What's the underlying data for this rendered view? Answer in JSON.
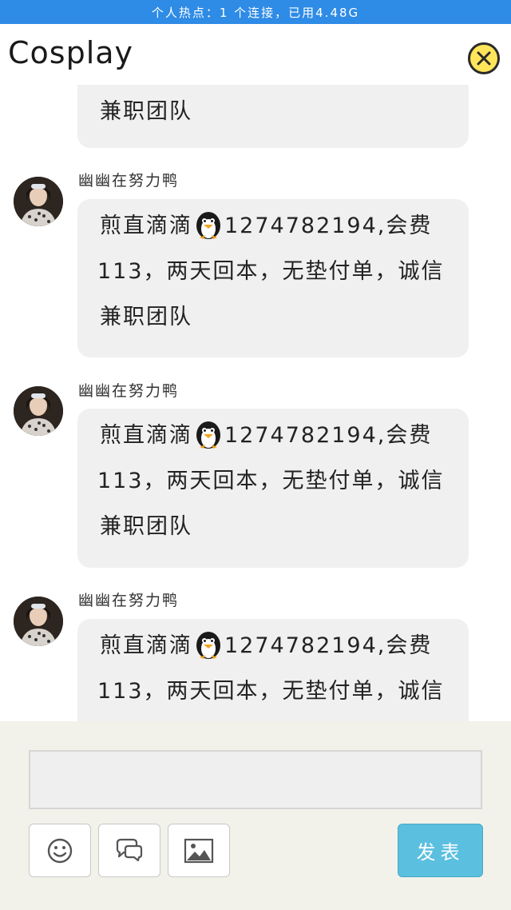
{
  "status_bar": {
    "text": "个人热点：1 个连接，已用4.48G"
  },
  "header": {
    "title": "Cosplay",
    "close_icon": "close-circle-icon",
    "close_color": "#ffe55a"
  },
  "messages": [
    {
      "username": "",
      "lines": [
        "兼职团队"
      ],
      "partial_top": true
    },
    {
      "username": "幽幽在努力鸭",
      "line1_before": "煎直滴滴",
      "line1_after": "1274782194,会费",
      "line2": "113，两天回本，无垫付单，诚信",
      "line3": "兼职团队"
    },
    {
      "username": "幽幽在努力鸭",
      "line1_before": "煎直滴滴",
      "line1_after": "1274782194,会费",
      "line2": "113，两天回本，无垫付单，诚信",
      "line3": "兼职团队"
    },
    {
      "username": "幽幽在努力鸭",
      "line1_before": "煎直滴滴",
      "line1_after": "1274782194,会费",
      "line2": "113，两天回本，无垫付单，诚信"
    }
  ],
  "composer": {
    "input_value": "",
    "input_placeholder": "",
    "emoji_icon": "smiley-icon",
    "chat_icon": "chat-bubbles-icon",
    "image_icon": "image-icon",
    "send_label": "发表",
    "send_color": "#5bbfe0"
  }
}
